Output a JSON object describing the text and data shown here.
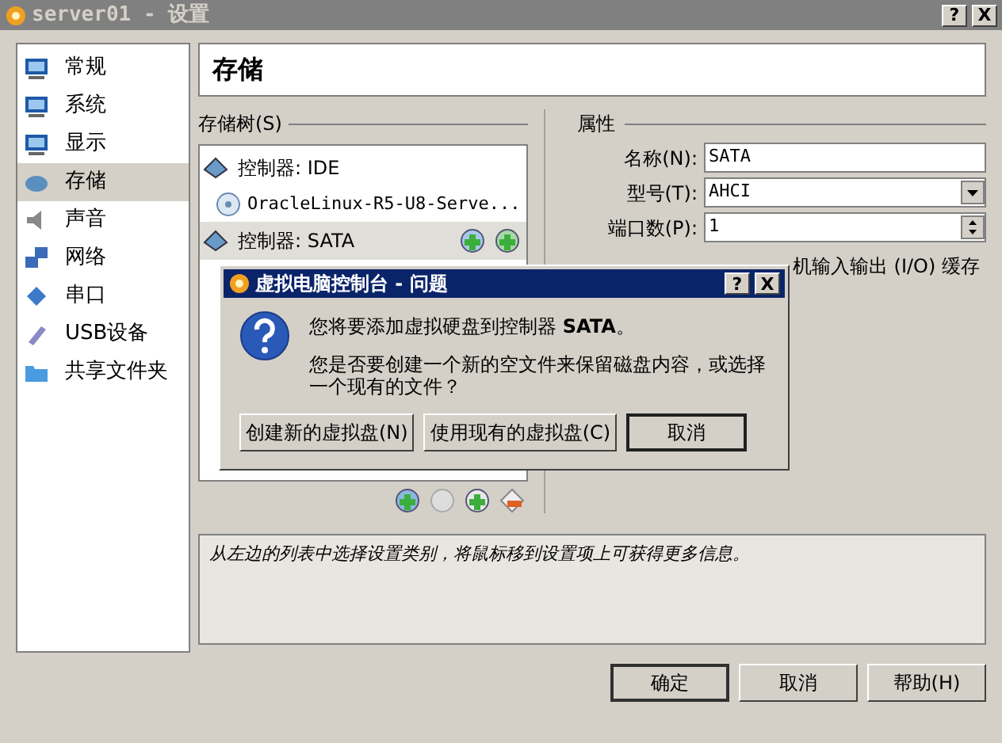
{
  "window": {
    "title": "server01 - 设置",
    "help_button": "?",
    "close_button": "X"
  },
  "sidebar": {
    "items": [
      {
        "label": "常规",
        "selected": false
      },
      {
        "label": "系统",
        "selected": false
      },
      {
        "label": "显示",
        "selected": false
      },
      {
        "label": "存储",
        "selected": true
      },
      {
        "label": "声音",
        "selected": false
      },
      {
        "label": "网络",
        "selected": false
      },
      {
        "label": "串口",
        "selected": false
      },
      {
        "label": "USB设备",
        "selected": false
      },
      {
        "label": "共享文件夹",
        "selected": false
      }
    ]
  },
  "page_title": "存储",
  "storage_tree": {
    "label": "存储树(S)",
    "items": [
      {
        "label": "控制器: IDE",
        "selected": false,
        "children": [
          {
            "label": "OracleLinux-R5-U8-Serve..."
          }
        ]
      },
      {
        "label": "控制器: SATA",
        "selected": true
      }
    ]
  },
  "properties": {
    "label": "属性",
    "fields": [
      {
        "kind": "text",
        "label": "名称(N):",
        "value": "SATA"
      },
      {
        "kind": "select",
        "label": "型号(T):",
        "value": "AHCI"
      },
      {
        "kind": "spin",
        "label": "端口数(P):",
        "value": "1"
      }
    ],
    "partial_text": "机输入输出 (I/O) 缓存"
  },
  "description": "从左边的列表中选择设置类别，将鼠标移到设置项上可获得更多信息。",
  "buttons": [
    {
      "label": "确定",
      "default": true
    },
    {
      "label": "取消",
      "default": false
    },
    {
      "label": "帮助(H)",
      "default": false
    }
  ],
  "dialog": {
    "title": "虚拟电脑控制台 - 问题",
    "help_button": "?",
    "close_button": "X",
    "message": "您将要添加虚拟硬盘到控制器 **SATA**。",
    "question": "您是否要创建一个新的空文件来保留磁盘内容，或选择一个现有的文件？",
    "buttons": [
      {
        "label": "创建新的虚拟盘(N)",
        "default": false
      },
      {
        "label": "使用现有的虚拟盘(C)",
        "default": false
      },
      {
        "label": "取消",
        "default": true
      }
    ]
  }
}
